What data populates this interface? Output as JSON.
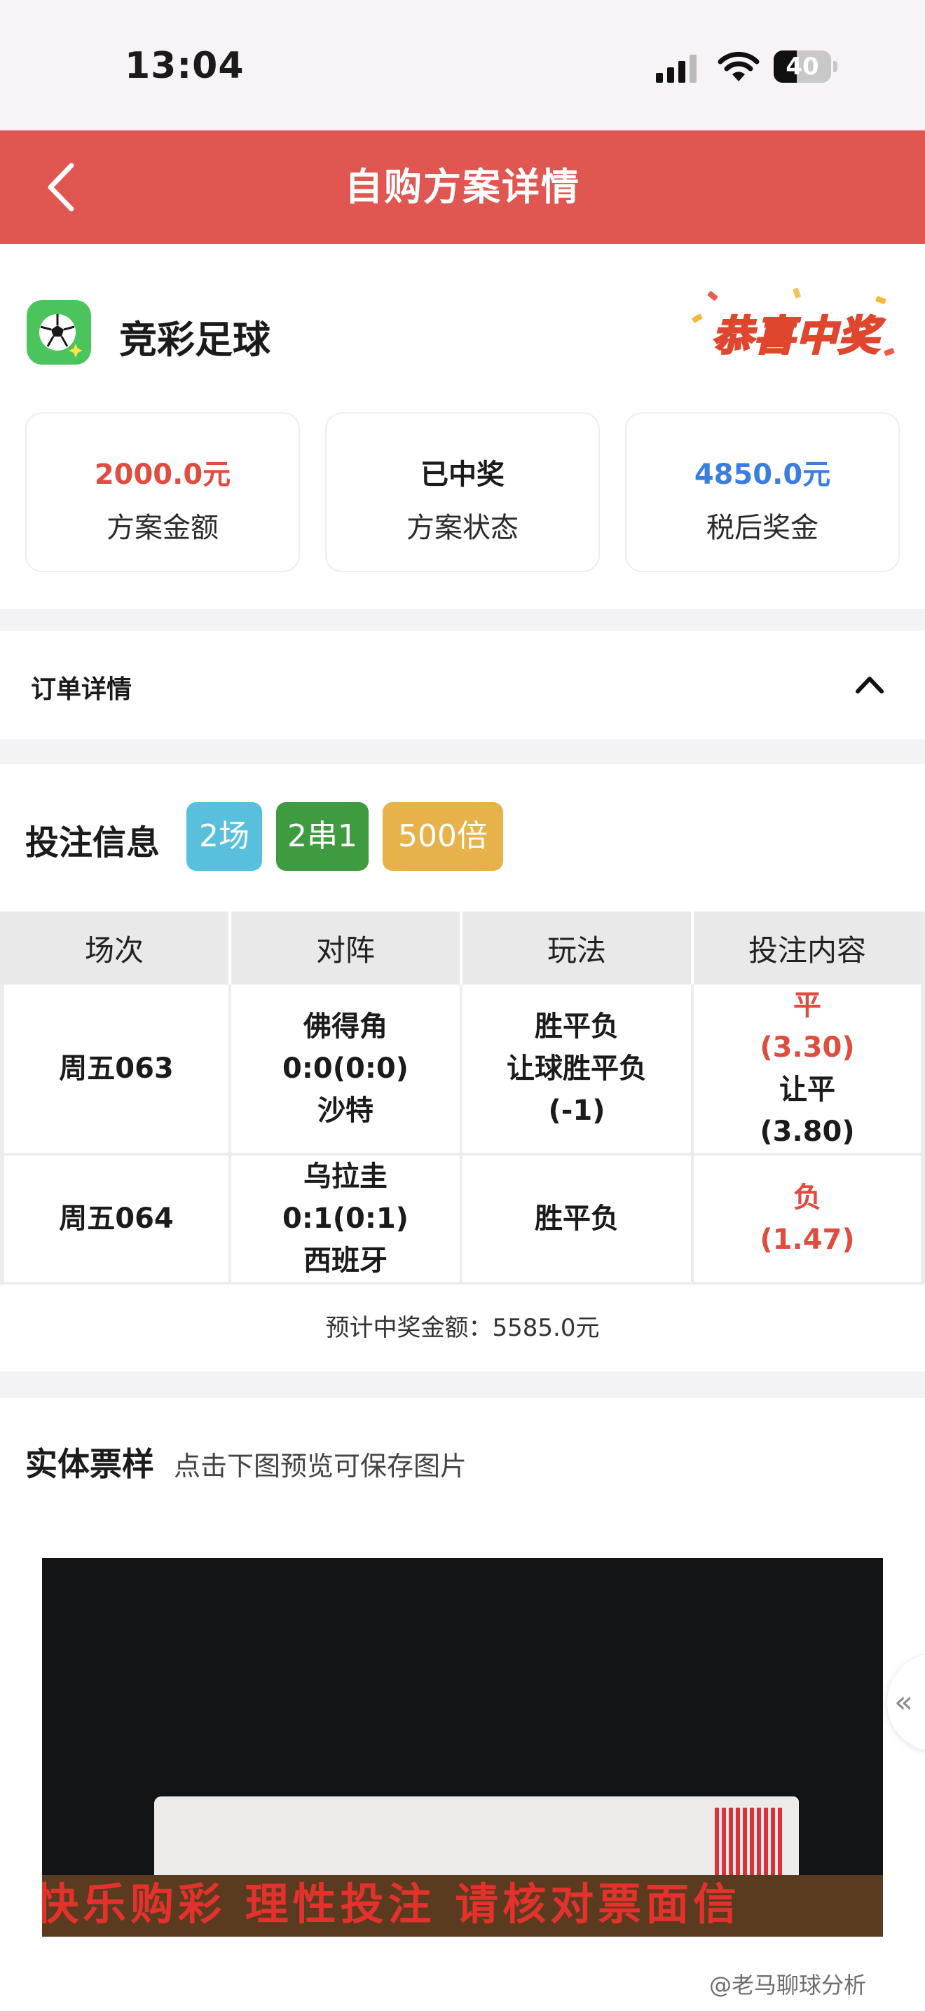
{
  "status_bar": {
    "time": "13:04",
    "battery": "40",
    "battery_level": 0.4
  },
  "nav": {
    "title": "自购方案详情"
  },
  "game": {
    "name": "竞彩足球",
    "badge": "恭喜中奖"
  },
  "stats": [
    {
      "value": "2000.0元",
      "label": "方案金额",
      "color": "#e04c3f"
    },
    {
      "value": "已中奖",
      "label": "方案状态",
      "color": "#1b1b1b"
    },
    {
      "value": "4850.0元",
      "label": "税后奖金",
      "color": "#3a7ee0"
    }
  ],
  "order": {
    "title": "订单详情"
  },
  "bet": {
    "title": "投注信息",
    "pills": [
      {
        "label": "2场",
        "color": "#58c0dc"
      },
      {
        "label": "2串1",
        "color": "#3f9b3f"
      },
      {
        "label": "500倍",
        "color": "#e8b24a"
      }
    ],
    "headers": [
      "场次",
      "对阵",
      "玩法",
      "投注内容"
    ],
    "rows": [
      {
        "match_no": "周五063",
        "teams": [
          "佛得角",
          "0:0(0:0)",
          "沙特"
        ],
        "plays": [
          "胜平负",
          "让球胜平负",
          "(-1)"
        ],
        "picks": [
          {
            "text": "平",
            "highlight": true
          },
          {
            "text": "(3.30)",
            "highlight": true
          },
          {
            "text": "让平",
            "highlight": false
          },
          {
            "text": "(3.80)",
            "highlight": false
          }
        ]
      },
      {
        "match_no": "周五064",
        "teams": [
          "乌拉圭",
          "0:1(0:1)",
          "西班牙"
        ],
        "plays": [
          "胜平负"
        ],
        "picks": [
          {
            "text": "负",
            "highlight": true
          },
          {
            "text": "(1.47)",
            "highlight": true
          }
        ]
      }
    ],
    "expected": "预计中奖金额：5585.0元"
  },
  "ticket": {
    "title": "实体票样",
    "hint": "点击下图预览可保存图片",
    "slogan": "快乐购彩  理性投注  请核对票面信"
  },
  "side_handle": "«",
  "watermark": "@老马聊球分析"
}
